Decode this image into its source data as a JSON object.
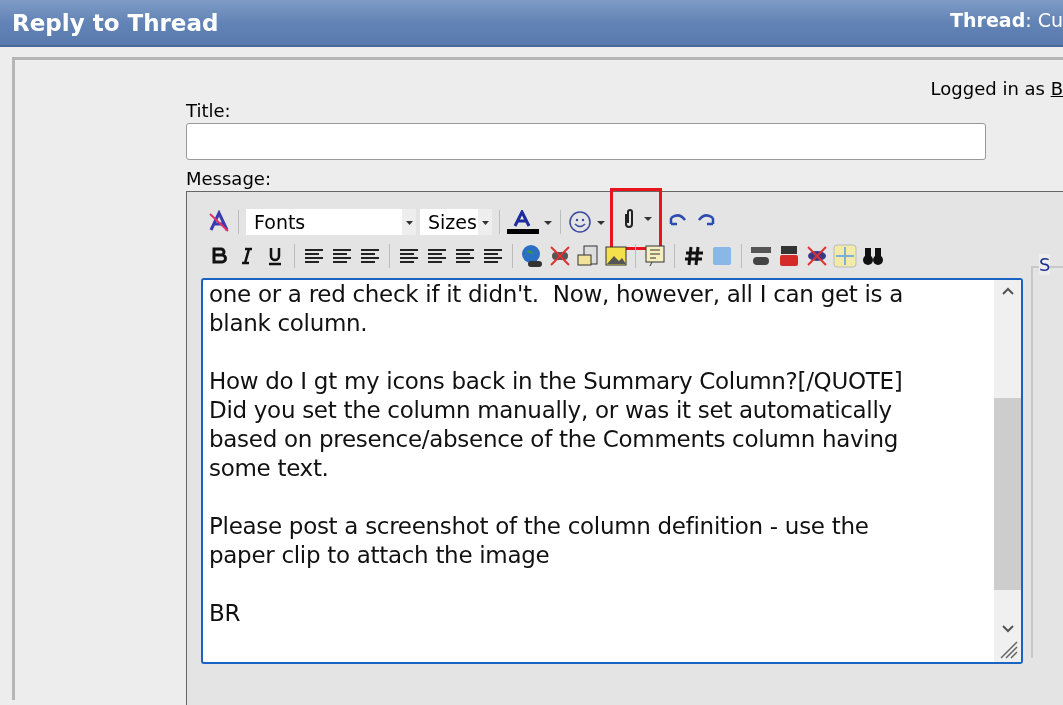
{
  "header": {
    "title": "Reply to Thread",
    "thread_label": "Thread",
    "thread_value": ": Cu"
  },
  "logged_in": {
    "text": "Logged in as ",
    "user": "B"
  },
  "title_field": {
    "label": "Title:"
  },
  "message": {
    "label": "Message:",
    "toolbar": {
      "font": "Fonts",
      "size": "Sizes",
      "attach_highlighted": true
    },
    "paragraphs": [
      "one or a red check if it didn't.  Now, however, all I can get is a\nblank column.",
      "How do I gt my icons back in the Summary Column?[/QUOTE]\nDid you set the column manually, or was it set automatically\nbased on presence/absence of the Comments column having\nsome text.",
      "Please post a screenshot of the column definition - use the\npaper clip to attach the image",
      "BR"
    ]
  },
  "side_legend": "S"
}
